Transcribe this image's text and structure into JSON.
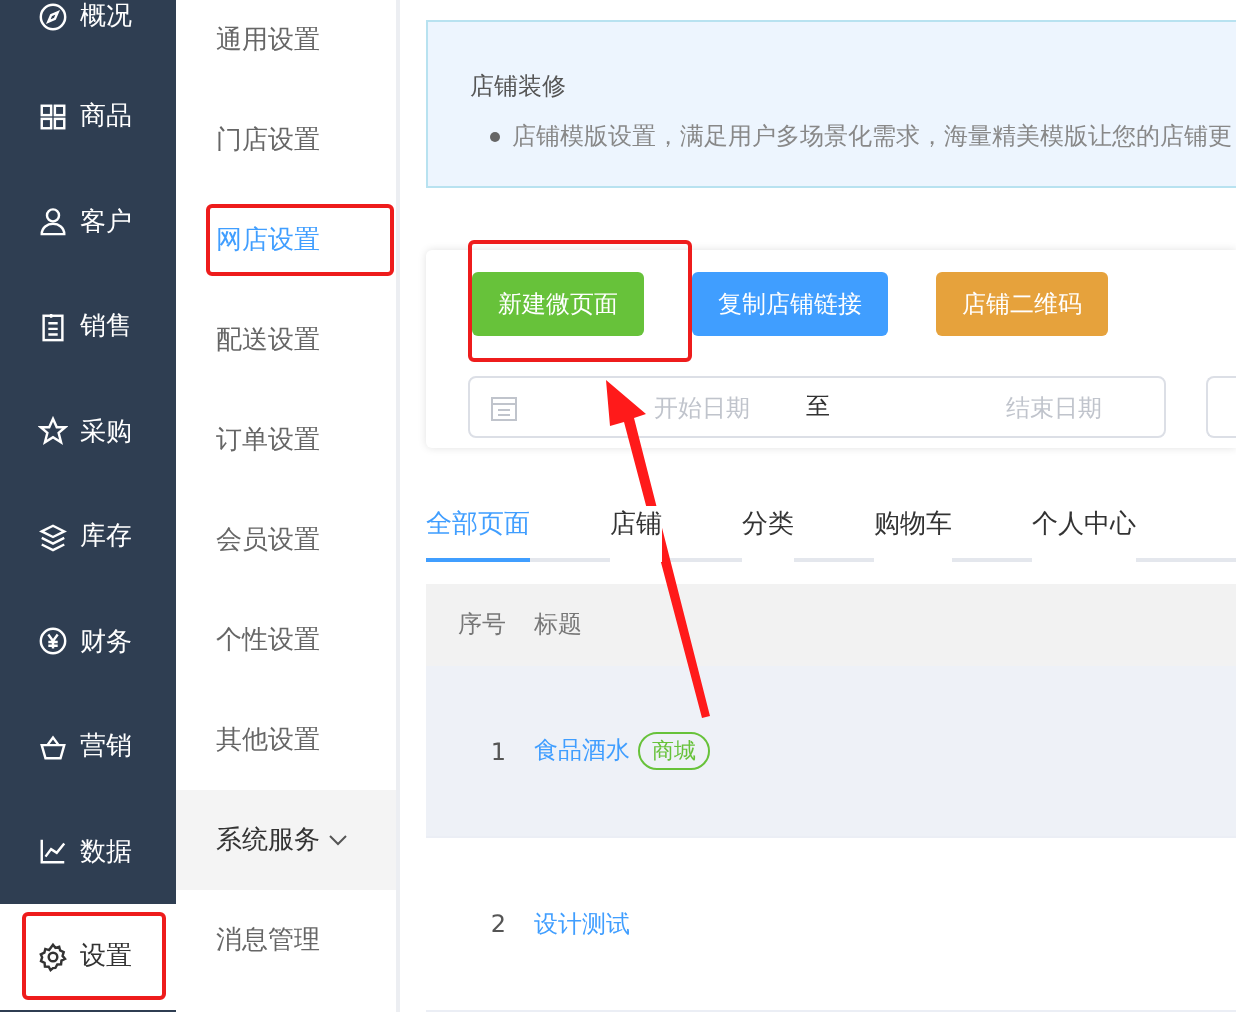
{
  "nav": [
    {
      "label": "概况",
      "selected": false,
      "highlighted": false
    },
    {
      "label": "商品",
      "selected": false,
      "highlighted": false
    },
    {
      "label": "客户",
      "selected": false,
      "highlighted": false
    },
    {
      "label": "销售",
      "selected": false,
      "highlighted": false
    },
    {
      "label": "采购",
      "selected": false,
      "highlighted": false
    },
    {
      "label": "库存",
      "selected": false,
      "highlighted": false
    },
    {
      "label": "财务",
      "selected": false,
      "highlighted": false
    },
    {
      "label": "营销",
      "selected": false,
      "highlighted": false
    },
    {
      "label": "数据",
      "selected": false,
      "highlighted": false
    },
    {
      "label": "设置",
      "selected": true,
      "highlighted": true
    }
  ],
  "submenu": [
    {
      "label": "通用设置",
      "kind": "item",
      "selected": false,
      "highlighted": false
    },
    {
      "label": "门店设置",
      "kind": "item",
      "selected": false,
      "highlighted": false
    },
    {
      "label": "网店设置",
      "kind": "item",
      "selected": true,
      "highlighted": true
    },
    {
      "label": "配送设置",
      "kind": "item",
      "selected": false,
      "highlighted": false
    },
    {
      "label": "订单设置",
      "kind": "item",
      "selected": false,
      "highlighted": false
    },
    {
      "label": "会员设置",
      "kind": "item",
      "selected": false,
      "highlighted": false
    },
    {
      "label": "个性设置",
      "kind": "item",
      "selected": false,
      "highlighted": false
    },
    {
      "label": "其他设置",
      "kind": "item",
      "selected": false,
      "highlighted": false
    },
    {
      "label": "系统服务",
      "kind": "group",
      "expanded": true,
      "highlighted": false
    },
    {
      "label": "消息管理",
      "kind": "item",
      "selected": false,
      "highlighted": false
    }
  ],
  "notice": {
    "title": "店铺装修",
    "text": "店铺模版设置，满足用户多场景化需求，海量精美模版让您的店铺更"
  },
  "buttons": [
    {
      "label": "新建微页面",
      "color": "#67c23a",
      "highlighted": true
    },
    {
      "label": "复制店铺链接",
      "color": "#409eff",
      "highlighted": false
    },
    {
      "label": "店铺二维码",
      "color": "#e6a23c",
      "highlighted": false
    }
  ],
  "date_range": {
    "start_placeholder": "开始日期",
    "separator": "至",
    "end_placeholder": "结束日期"
  },
  "tabs": [
    {
      "label": "全部页面",
      "selected": true
    },
    {
      "label": "店铺",
      "selected": false
    },
    {
      "label": "分类",
      "selected": false
    },
    {
      "label": "购物车",
      "selected": false
    },
    {
      "label": "个人中心",
      "selected": false
    }
  ],
  "table": {
    "columns": [
      "序号",
      "标题"
    ],
    "rows": [
      {
        "index": "1",
        "title": "食品酒水",
        "tag": "商城",
        "hovered": true
      },
      {
        "index": "2",
        "title": "设计测试",
        "hovered": false
      }
    ]
  },
  "annotation_arrow": true
}
